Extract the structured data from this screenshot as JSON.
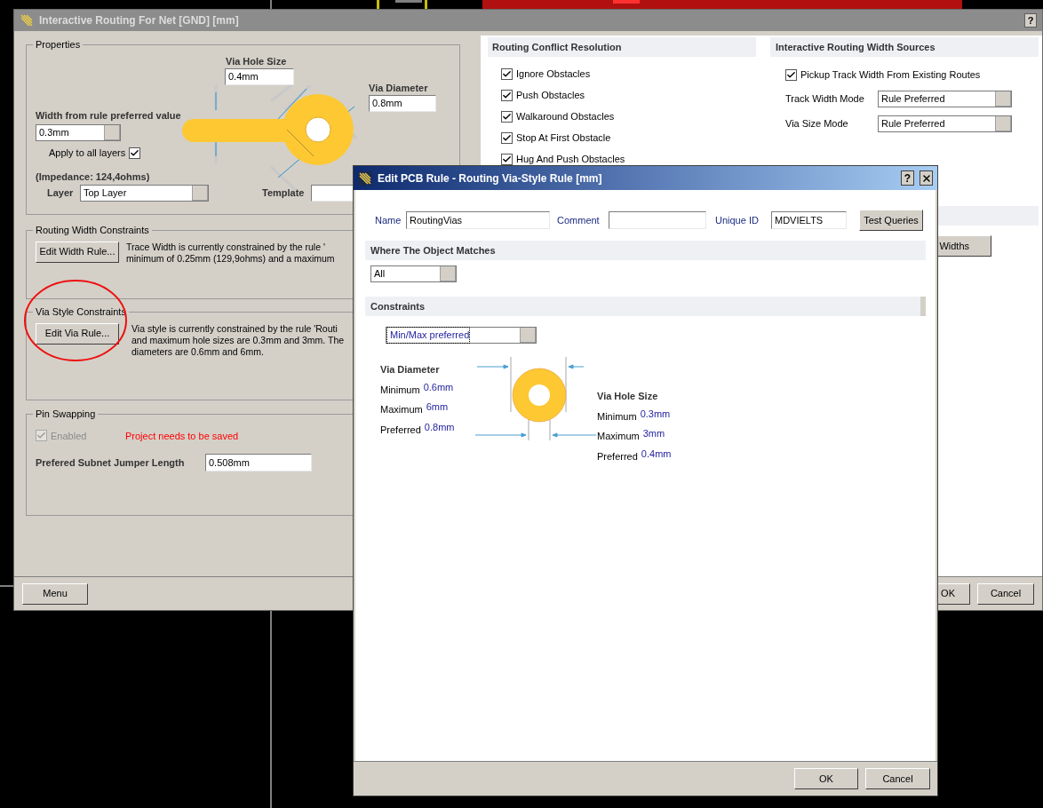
{
  "background_window": {
    "title": "Interactive Routing For Net [GND] [mm]",
    "help_button": "?",
    "properties": {
      "title": "Properties",
      "via_hole_size": {
        "label": "Via Hole Size",
        "value": "0.4mm"
      },
      "via_diameter": {
        "label": "Via Diameter",
        "value": "0.8mm"
      },
      "width": {
        "label": "Width from rule preferred value",
        "value": "0.3mm"
      },
      "apply_all_layers": {
        "label": "Apply to all layers",
        "checked": true
      },
      "impedance": "(Impedance: 124,4ohms)",
      "layer": {
        "label": "Layer",
        "value": "Top Layer"
      },
      "template": {
        "label": "Template"
      }
    },
    "routing_width_constraints": {
      "title": "Routing Width Constraints",
      "button": "Edit Width Rule...",
      "description": [
        "Trace Width is currently constrained by the rule '",
        "minimum of 0.25mm (129,9ohms) and a maximum"
      ]
    },
    "via_style_constraints": {
      "title": "Via Style Constraints",
      "button": "Edit Via Rule...",
      "description": [
        "Via style is currently constrained by the rule 'Routi",
        "and maximum hole sizes are 0.3mm and 3mm. The",
        "diameters are 0.6mm and 6mm."
      ]
    },
    "pin_swapping": {
      "title": "Pin Swapping",
      "enabled": {
        "label": "Enabled",
        "checked": true,
        "disabled": true
      },
      "warning": "Project needs to be saved",
      "jumper_length": {
        "label": "Prefered Subnet Jumper Length",
        "value": "0.508mm"
      }
    },
    "routing_conflict_resolution": {
      "title": "Routing Conflict Resolution",
      "options": [
        {
          "label": "Ignore Obstacles",
          "checked": true
        },
        {
          "label": "Push Obstacles",
          "checked": true
        },
        {
          "label": "Walkaround Obstacles",
          "checked": true
        },
        {
          "label": "Stop At First Obstacle",
          "checked": true
        },
        {
          "label": "Hug And Push Obstacles",
          "checked": true
        }
      ]
    },
    "width_sources": {
      "title": "Interactive Routing Width Sources",
      "pickup": {
        "label": "Pickup Track Width From Existing Routes",
        "checked": true
      },
      "track_width_mode": {
        "label": "Track Width Mode",
        "value": "Rule Preferred"
      },
      "via_size_mode": {
        "label": "Via Size Mode",
        "value": "Rule Preferred"
      },
      "widths_button": "Widths"
    },
    "footer": {
      "menu_button": "Menu",
      "ok_button": "OK",
      "cancel_button": "Cancel"
    }
  },
  "dialog": {
    "title": "Edit PCB Rule - Routing Via-Style Rule [mm]",
    "help_button": "?",
    "name": {
      "label": "Name",
      "value": "RoutingVias"
    },
    "comment": {
      "label": "Comment"
    },
    "unique_id": {
      "label": "Unique ID",
      "value": "MDVIELTS"
    },
    "test_queries_button": "Test Queries",
    "where_matches": {
      "title": "Where The Object Matches",
      "value": "All"
    },
    "constraints": {
      "title": "Constraints",
      "mode": "Min/Max preferred",
      "via_diameter": {
        "title": "Via Diameter",
        "rows": [
          {
            "label": "Minimum",
            "value": "0.6mm"
          },
          {
            "label": "Maximum",
            "value": "6mm"
          },
          {
            "label": "Preferred",
            "value": "0.8mm"
          }
        ]
      },
      "via_hole_size": {
        "title": "Via Hole Size",
        "rows": [
          {
            "label": "Minimum",
            "value": "0.3mm"
          },
          {
            "label": "Maximum",
            "value": "3mm"
          },
          {
            "label": "Preferred",
            "value": "0.4mm"
          }
        ]
      }
    },
    "footer": {
      "ok_button": "OK",
      "cancel_button": "Cancel"
    }
  }
}
